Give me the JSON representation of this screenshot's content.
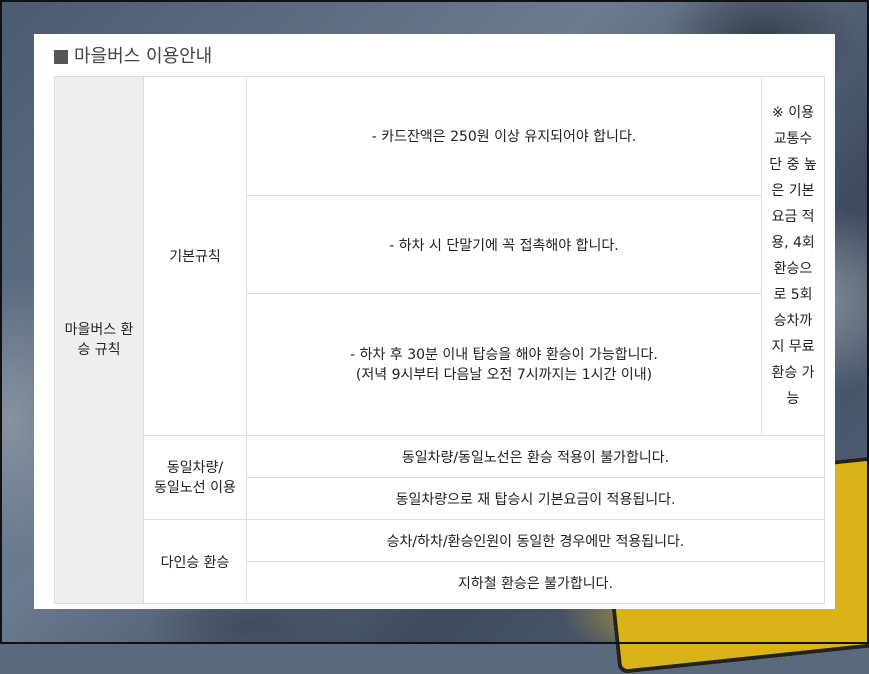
{
  "title": "마을버스 이용안내",
  "section": {
    "label_line1": "마을버스 환",
    "label_line2": "승 규칙"
  },
  "groups": [
    {
      "label": "기본규칙",
      "rows": [
        {
          "text": "- 카드잔액은 250원 이상 유지되어야 합니다."
        },
        {
          "text": "- 하차 시 단말기에 꼭 접촉해야 합니다."
        },
        {
          "text": "- 하차 후 30분 이내 탑승을 해야 환승이 가능합니다.",
          "sub": "(저녁 9시부터 다음날 오전 7시까지는 1시간 이내)"
        }
      ],
      "note_lines": [
        "※ 이용",
        "교통수",
        "단 중 높",
        "은 기본",
        "요금 적",
        "용, 4회",
        "환승으",
        "로 5회",
        "승차까",
        "지 무료",
        "환승 가",
        "능"
      ]
    },
    {
      "label_line1": "동일차량/",
      "label_line2": "동일노선 이용",
      "rows": [
        {
          "text": "동일차량/동일노선은 환승 적용이 불가합니다."
        },
        {
          "text": "동일차량으로 재 탑승시 기본요금이 적용됩니다."
        }
      ]
    },
    {
      "label": "다인승 환승",
      "rows": [
        {
          "text": "승차/하차/환승인원이 동일한 경우에만 적용됩니다."
        },
        {
          "text": "지하철 환승은 불가합니다."
        }
      ]
    }
  ]
}
